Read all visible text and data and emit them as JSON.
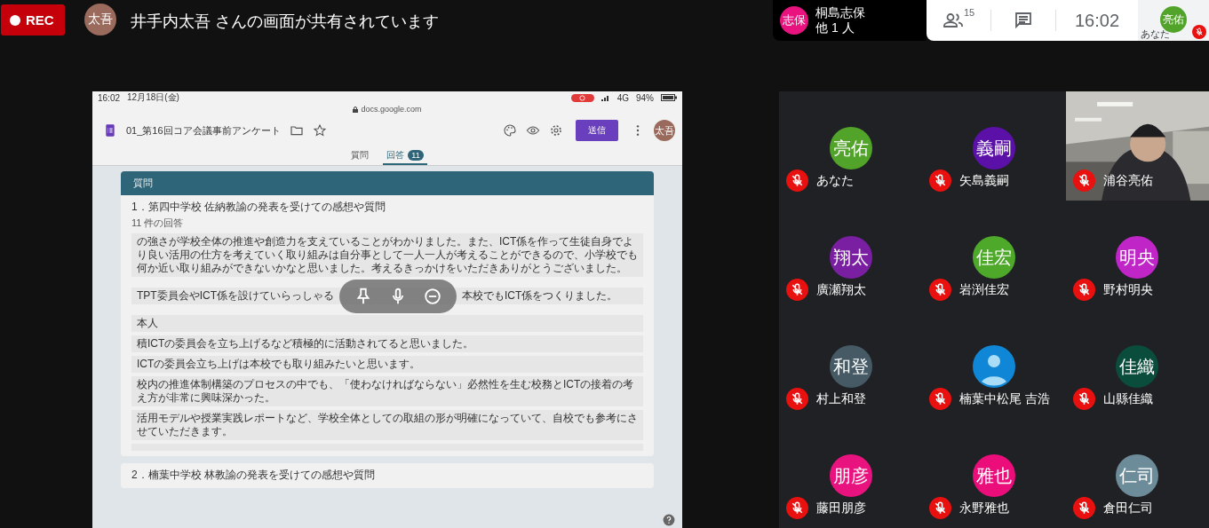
{
  "recording": {
    "label": "REC"
  },
  "presenter": {
    "initials": "太吾",
    "color": "#9a6a5c",
    "message": "井手内太吾 さんの画面が共有されています"
  },
  "speaker": {
    "initials": "志保",
    "color": "#e8137e",
    "name": "桐島志保",
    "others": "他 1 人"
  },
  "controls": {
    "participant_count": "15",
    "time": "16:02",
    "self": {
      "initials": "亮佑",
      "color": "#52a32a",
      "label": "あなた",
      "muted": true
    }
  },
  "shared_screen": {
    "status_bar": {
      "time": "16:02",
      "date": "12月18日(金)",
      "network": "4G",
      "battery": "94%"
    },
    "url": "docs.google.com",
    "form": {
      "title": "01_第16回コア会議事前アンケート",
      "send_button": "送信",
      "avatar": "太吾",
      "tabs": [
        {
          "label": "質問",
          "selected": false
        },
        {
          "label": "回答",
          "selected": true,
          "badge": "11"
        }
      ],
      "section_header": "質問",
      "questions": [
        {
          "title": "1．第四中学校 佐納教諭の発表を受けての感想や質問",
          "count": "11 件の回答",
          "responses": [
            "の強さが学校全体の推進や創造力を支えていることがわかりました。また、ICT係を作って生徒自身でより良い活用の仕方を考えていく取り組みは自分事として一人一人が考えることができるので、小学校でも何か近い取り組みができないかなと思いました。考えるきっかけをいただきありがとうございました。",
            {
              "parts": [
                "TPT委員会やICT係を設けていらっしゃる",
                "本校でもICT係をつくりました。"
              ]
            },
            "本人",
            "積ICTの委員会を立ち上げるなど積極的に活動されてると思いました。",
            "ICTの委員会立ち上げは本校でも取り組みたいと思います。",
            "校内の推進体制構築のプロセスの中でも、「使わなければならない」必然性を生む校務とICTの接着の考え方が非常に興味深かった。",
            "活用モデルや授業実践レポートなど、学校全体としての取組の形が明確になっていて、自校でも参考にさせていただきます。"
          ]
        },
        {
          "title": "2．楠葉中学校 林教諭の発表を受けての感想や質問"
        }
      ]
    }
  },
  "participants": [
    {
      "kind": "avatar",
      "initials": "亮佑",
      "color": "#52a32a",
      "name": "あなた",
      "muted": true
    },
    {
      "kind": "avatar",
      "initials": "義嗣",
      "color": "#5b10a8",
      "name": "矢島義嗣",
      "muted": true
    },
    {
      "kind": "video",
      "name": "浦谷亮佑",
      "muted": true
    },
    {
      "kind": "avatar",
      "initials": "翔太",
      "color": "#7b1fa2",
      "name": "廣瀬翔太",
      "muted": true
    },
    {
      "kind": "avatar",
      "initials": "佳宏",
      "color": "#4ea82a",
      "name": "岩渕佳宏",
      "muted": true
    },
    {
      "kind": "avatar",
      "initials": "明央",
      "color": "#c026c7",
      "name": "野村明央",
      "muted": true
    },
    {
      "kind": "avatar",
      "initials": "和登",
      "color": "#455a64",
      "name": "村上和登",
      "muted": true
    },
    {
      "kind": "default",
      "name": "楠葉中松尾 吉浩",
      "muted": true
    },
    {
      "kind": "avatar",
      "initials": "佳織",
      "color": "#0b4d3c",
      "name": "山縣佳織",
      "muted": true
    },
    {
      "kind": "avatar",
      "initials": "朋彦",
      "color": "#e8137e",
      "name": "藤田朋彦",
      "muted": true
    },
    {
      "kind": "avatar",
      "initials": "雅也",
      "color": "#ea0d7a",
      "name": "永野雅也",
      "muted": true
    },
    {
      "kind": "avatar",
      "initials": "仁司",
      "color": "#6d8c99",
      "name": "倉田仁司",
      "muted": true
    }
  ]
}
